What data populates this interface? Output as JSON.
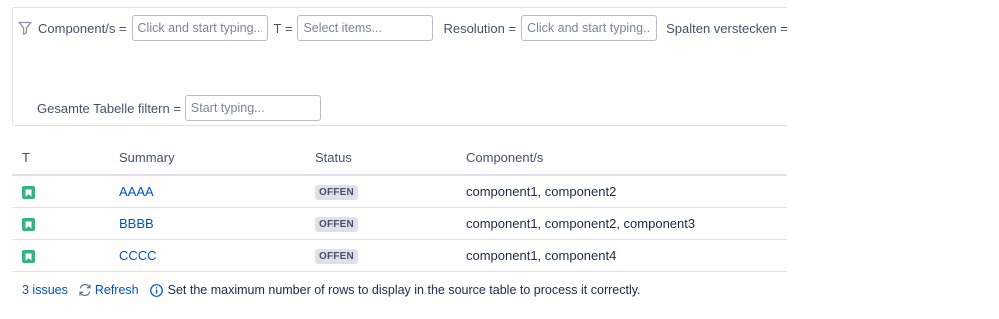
{
  "filters": {
    "component_label": "Component/s =",
    "component_placeholder": "Click and start typing...",
    "type_label": "T =",
    "type_placeholder": "Select items...",
    "resolution_label": "Resolution =",
    "resolution_placeholder": "Click and start typing...",
    "hide_columns_label": "Spalten verstecken =",
    "table_filter_label": "Gesamte Tabelle filtern =",
    "table_filter_placeholder": "Start typing..."
  },
  "table": {
    "columns": [
      "T",
      "Summary",
      "Status",
      "Component/s"
    ],
    "rows": [
      {
        "summary": "AAAA",
        "status": "OFFEN",
        "components": "component1, component2"
      },
      {
        "summary": "BBBB",
        "status": "OFFEN",
        "components": "component1, component2, component3"
      },
      {
        "summary": "CCCC",
        "status": "OFFEN",
        "components": "component1, component4"
      }
    ]
  },
  "footer": {
    "count": "3 issues",
    "refresh": "Refresh",
    "info": "Set the maximum number of rows to display in the source table to process it correctly."
  },
  "colors": {
    "accent": "#0052cc",
    "type_icon": "#36b37e",
    "lozenge_bg": "#dfe1e6"
  },
  "icons": {
    "filter": "funnel-icon",
    "type": "story-icon",
    "refresh": "refresh-icon",
    "info": "info-icon"
  }
}
